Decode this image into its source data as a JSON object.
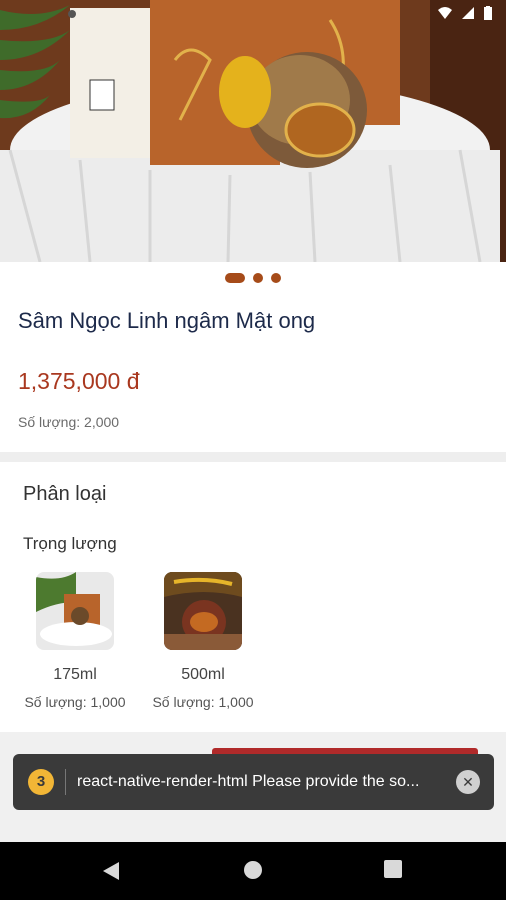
{
  "product": {
    "title": "Sâm Ngọc Linh ngâm Mật ong",
    "price": "1,375,000 đ",
    "quantity": "Số lượng: 2,000"
  },
  "gallery": {
    "slides": 3,
    "active_index": 0
  },
  "variants": {
    "section_title": "Phân loại",
    "group_label": "Trọng lượng",
    "items": [
      {
        "name": "175ml",
        "quantity": "Số lượng: 1,000"
      },
      {
        "name": "500ml",
        "quantity": "Số lượng: 1,000"
      }
    ]
  },
  "toast": {
    "count": "3",
    "message": "react-native-render-html Please provide the so..."
  },
  "colors": {
    "brand": "#a64b19",
    "price": "#a9381f",
    "toast_bg": "#3a3a3a",
    "badge": "#f2b636"
  },
  "icons": {
    "status": [
      "wifi-icon",
      "signal-icon",
      "battery-icon"
    ],
    "nav": [
      "back-icon",
      "home-icon",
      "recents-icon"
    ]
  }
}
